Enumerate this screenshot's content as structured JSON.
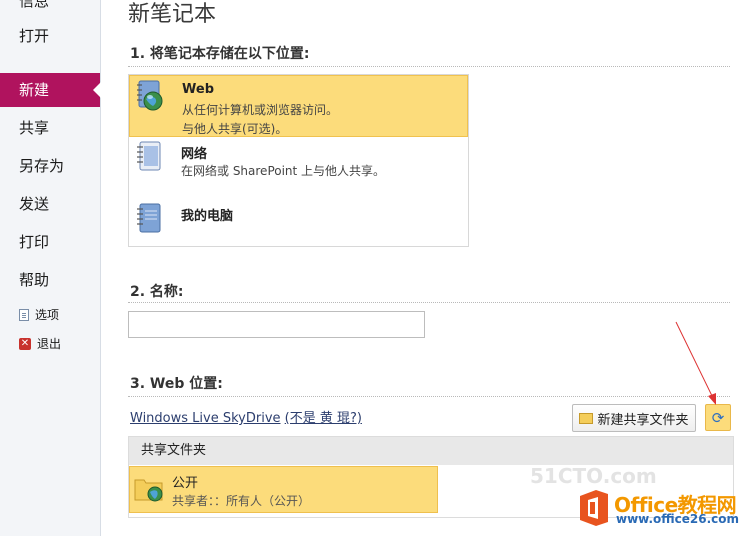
{
  "sidebar": {
    "items": [
      {
        "label": "信息"
      },
      {
        "label": "打开"
      },
      {
        "label": "新建"
      },
      {
        "label": "共享"
      },
      {
        "label": "另存为"
      },
      {
        "label": "发送"
      },
      {
        "label": "打印"
      },
      {
        "label": "帮助"
      },
      {
        "label": "选项"
      },
      {
        "label": "退出"
      }
    ],
    "active": "新建",
    "accent": "#b0135e"
  },
  "page": {
    "title": "新笔记本"
  },
  "section1": {
    "heading": "1. 将笔记本存储在以下位置:",
    "locations": [
      {
        "name": "Web",
        "desc1": "从任何计算机或浏览器访问。",
        "desc2": "与他人共享(可选)。",
        "icon": "globe-notebook-icon",
        "selected": true
      },
      {
        "name": "网络",
        "desc1": "在网络或 SharePoint 上与他人共享。",
        "desc2": "",
        "icon": "network-notebook-icon",
        "selected": false
      },
      {
        "name": "我的电脑",
        "desc1": "",
        "desc2": "",
        "icon": "notebook-icon",
        "selected": false
      }
    ]
  },
  "section2": {
    "heading": "2. 名称:",
    "name_value": ""
  },
  "section3": {
    "heading": "3. Web 位置:",
    "account_link": "Windows Live SkyDrive",
    "not_you_link": "(不是 黄 琨?)",
    "new_folder_label": "新建共享文件夹",
    "refresh_icon": "refresh-icon",
    "folders_header": "共享文件夹",
    "folders": [
      {
        "name": "公开",
        "shared": "共享者：：所有人（公开）"
      }
    ]
  },
  "watermark": {
    "site": "51CTO.com",
    "logo_text": "Office教程网",
    "logo_url": "www.office26.com"
  },
  "colors": {
    "selection": "#fcdc7b",
    "selection_border": "#f0c24f",
    "arrow": "#d33"
  }
}
